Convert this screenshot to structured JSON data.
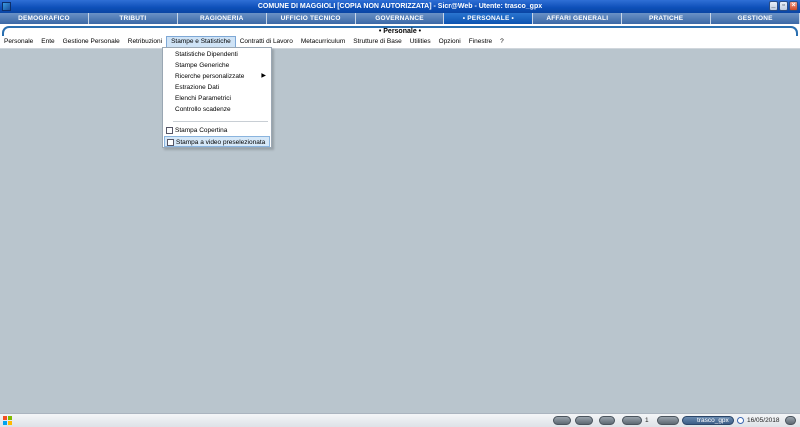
{
  "window": {
    "title": "COMUNE DI MAGGIOLI  [COPIA NON AUTORIZZATA]  -  Sicr@Web  -  Utente: trasco_gpx",
    "controls": [
      "_",
      "▫",
      "×"
    ]
  },
  "modules": [
    {
      "label": "DEMOGRAFICO",
      "active": false
    },
    {
      "label": "TRIBUTI",
      "active": false
    },
    {
      "label": "RAGIONERIA",
      "active": false
    },
    {
      "label": "UFFICIO TECNICO",
      "active": false
    },
    {
      "label": "GOVERNANCE",
      "active": false
    },
    {
      "label": "• PERSONALE •",
      "active": true
    },
    {
      "label": "AFFARI GENERALI",
      "active": false
    },
    {
      "label": "PRATICHE",
      "active": false
    },
    {
      "label": "GESTIONE",
      "active": false
    }
  ],
  "subheader": {
    "title": "• Personale •"
  },
  "menubar": [
    "Personale",
    "Ente",
    "Gestione Personale",
    "Retribuzioni",
    "Stampe e Statistiche",
    "Contratti di Lavoro",
    "Metacurriculum",
    "Strutture di Base",
    "Utilities",
    "Opzioni",
    "Finestre",
    "?"
  ],
  "dropdown": {
    "items": [
      {
        "label": "Statistiche Dipendenti"
      },
      {
        "label": "Stampe Generiche"
      },
      {
        "label": "Ricerche personalizzate",
        "submenu": "▶"
      },
      {
        "label": "Estrazione Dati"
      },
      {
        "label": "Elenchi Parametrici"
      },
      {
        "label": "Controllo scadenze"
      },
      {
        "label": "Stampa Copertina",
        "checkbox": true
      },
      {
        "label": "Stampa a video preselezionata",
        "checkbox": true,
        "highlight": true
      }
    ]
  },
  "taskbar": {
    "counter": "1",
    "user": "trasco_gpx",
    "date": "16/05/2018",
    "colors": {
      "win_red": "#f25022",
      "win_green": "#7fba00",
      "win_blue": "#00a4ef",
      "win_yellow": "#ffb900"
    }
  }
}
